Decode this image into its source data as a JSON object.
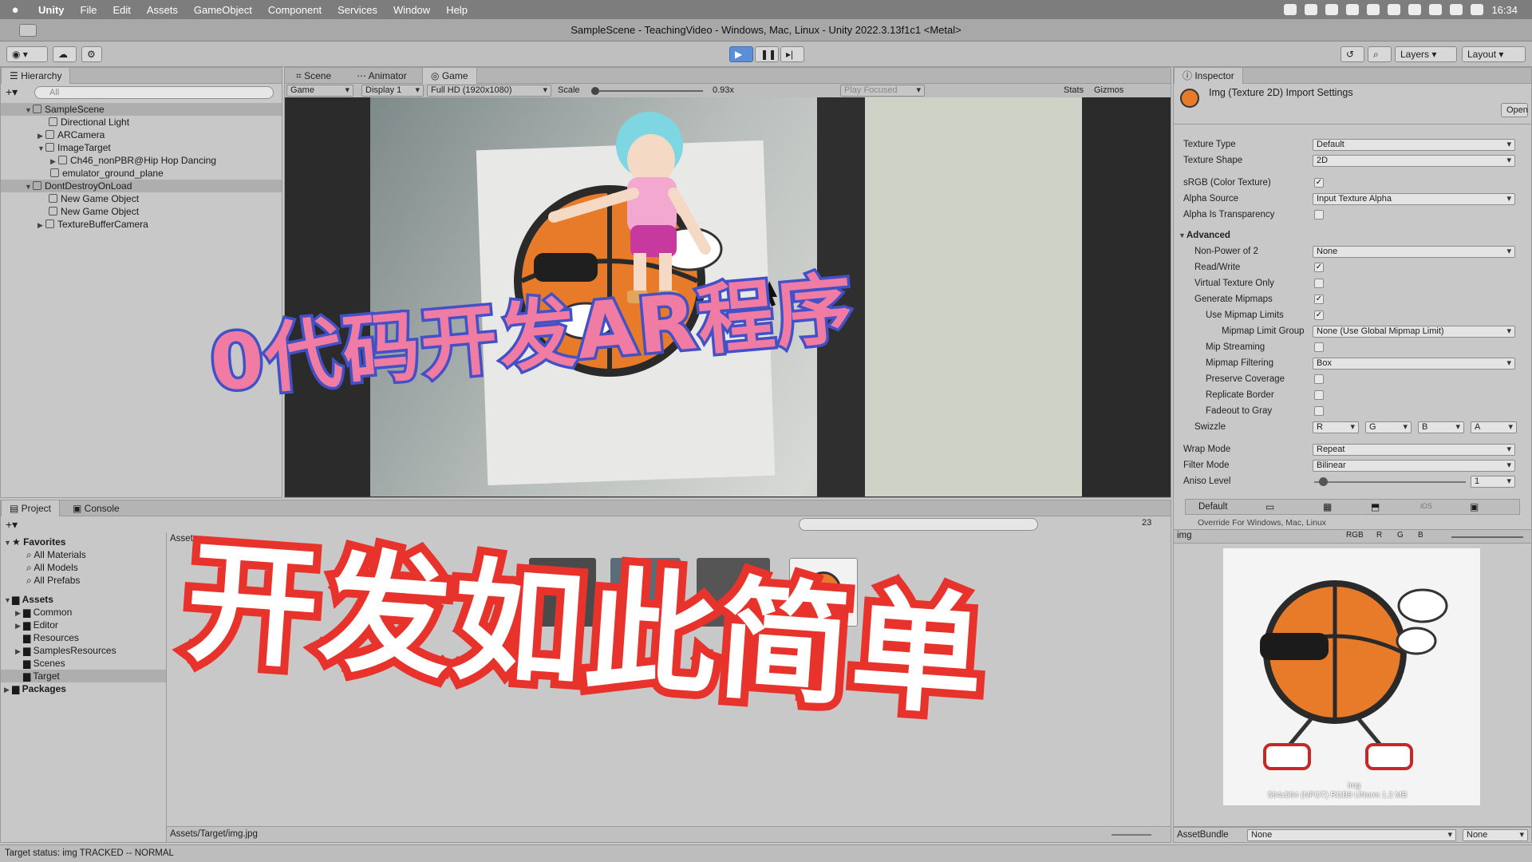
{
  "menubar": {
    "apple_icon": "apple-icon",
    "items": [
      "Unity",
      "File",
      "Edit",
      "Assets",
      "GameObject",
      "Component",
      "Services",
      "Window",
      "Help"
    ],
    "clock": "16:34"
  },
  "titlebar": {
    "title": "SampleScene - TeachingVideo - Windows, Mac, Linux - Unity 2022.3.13f1c1 <Metal>"
  },
  "toolbar": {
    "layers": "Layers",
    "layout": "Layout"
  },
  "hierarchy": {
    "tab": "Hierarchy",
    "search_placeholder": "All",
    "items": [
      {
        "label": "SampleScene"
      },
      {
        "label": "Directional Light"
      },
      {
        "label": "ARCamera"
      },
      {
        "label": "ImageTarget"
      },
      {
        "label": "Ch46_nonPBR@Hip Hop Dancing"
      },
      {
        "label": "emulator_ground_plane"
      },
      {
        "label": "DontDestroyOnLoad"
      },
      {
        "label": "New Game Object"
      },
      {
        "label": "New Game Object"
      },
      {
        "label": "TextureBufferCamera"
      }
    ]
  },
  "gameview": {
    "tabs": [
      "Scene",
      "Animator",
      "Game"
    ],
    "game_dropdown": "Game",
    "display": "Display 1",
    "resolution": "Full HD (1920x1080)",
    "scale_label": "Scale",
    "scale_value": "0.93x",
    "play_focused": "Play Focused",
    "stats": "Stats",
    "gizmos": "Gizmos"
  },
  "inspector": {
    "tab": "Inspector",
    "header": "Img (Texture 2D) Import Settings",
    "open_button": "Open",
    "texture_type_label": "Texture Type",
    "texture_type": "Default",
    "texture_shape_label": "Texture Shape",
    "texture_shape": "2D",
    "srgb_label": "sRGB (Color Texture)",
    "alpha_source_label": "Alpha Source",
    "alpha_source": "Input Texture Alpha",
    "alpha_transparency_label": "Alpha Is Transparency",
    "advanced_label": "Advanced",
    "npot_label": "Non-Power of 2",
    "npot": "None",
    "readwrite_label": "Read/Write",
    "virtual_texture_label": "Virtual Texture Only",
    "gen_mipmaps_label": "Generate Mipmaps",
    "use_mipmap_limits_label": "Use Mipmap Limits",
    "mipmap_limit_group_label": "Mipmap Limit Group",
    "mipmap_limit_group": "None (Use Global Mipmap Limit)",
    "mip_streaming_label": "Mip Streaming",
    "mipmap_filtering_label": "Mipmap Filtering",
    "mipmap_filtering": "Box",
    "preserve_coverage_label": "Preserve Coverage",
    "replicate_border_label": "Replicate Border",
    "fadeout_label": "Fadeout to Gray",
    "swizzle_label": "Swizzle",
    "swizzle": [
      "R",
      "G",
      "B",
      "A"
    ],
    "wrap_mode_label": "Wrap Mode",
    "wrap_mode": "Repeat",
    "filter_mode_label": "Filter Mode",
    "filter_mode": "Bilinear",
    "aniso_label": "Aniso Level",
    "aniso": "1",
    "platform_default": "Default",
    "platform_override": "Override For Windows, Mac, Linux",
    "preview_name": "img",
    "preview_channels": [
      "RGB",
      "R",
      "G",
      "B"
    ],
    "preview_caption_name": "img",
    "preview_caption_info": "564x564 (NPOT)  RGB8 UNorm   1.2 MB",
    "assetbundle_label": "AssetBundle",
    "assetbundle_value": "None",
    "assetbundle_variant": "None"
  },
  "project": {
    "tabs": [
      "Project",
      "Console"
    ],
    "favorites_label": "Favorites",
    "favorites": [
      "All Materials",
      "All Models",
      "All Prefabs"
    ],
    "assets_label": "Assets",
    "folders": [
      "Common",
      "Editor",
      "Resources",
      "SamplesResources",
      "Scenes",
      "Target"
    ],
    "packages_label": "Packages",
    "breadcrumb": "Assets",
    "count": "23",
    "footer_path": "Assets/Target/img.jpg"
  },
  "statusbar": {
    "text": "Target status: img TRACKED -- NORMAL"
  },
  "overlay": {
    "caption1": "0代码开发AR程序",
    "caption2": "开发如此简单"
  },
  "colors": {
    "caption1_fill": "#f07ca4",
    "caption1_stroke": "#4351c7",
    "caption2_fill": "#ffffff",
    "caption2_stroke": "#e8332d",
    "play": "#5a8fd6"
  }
}
